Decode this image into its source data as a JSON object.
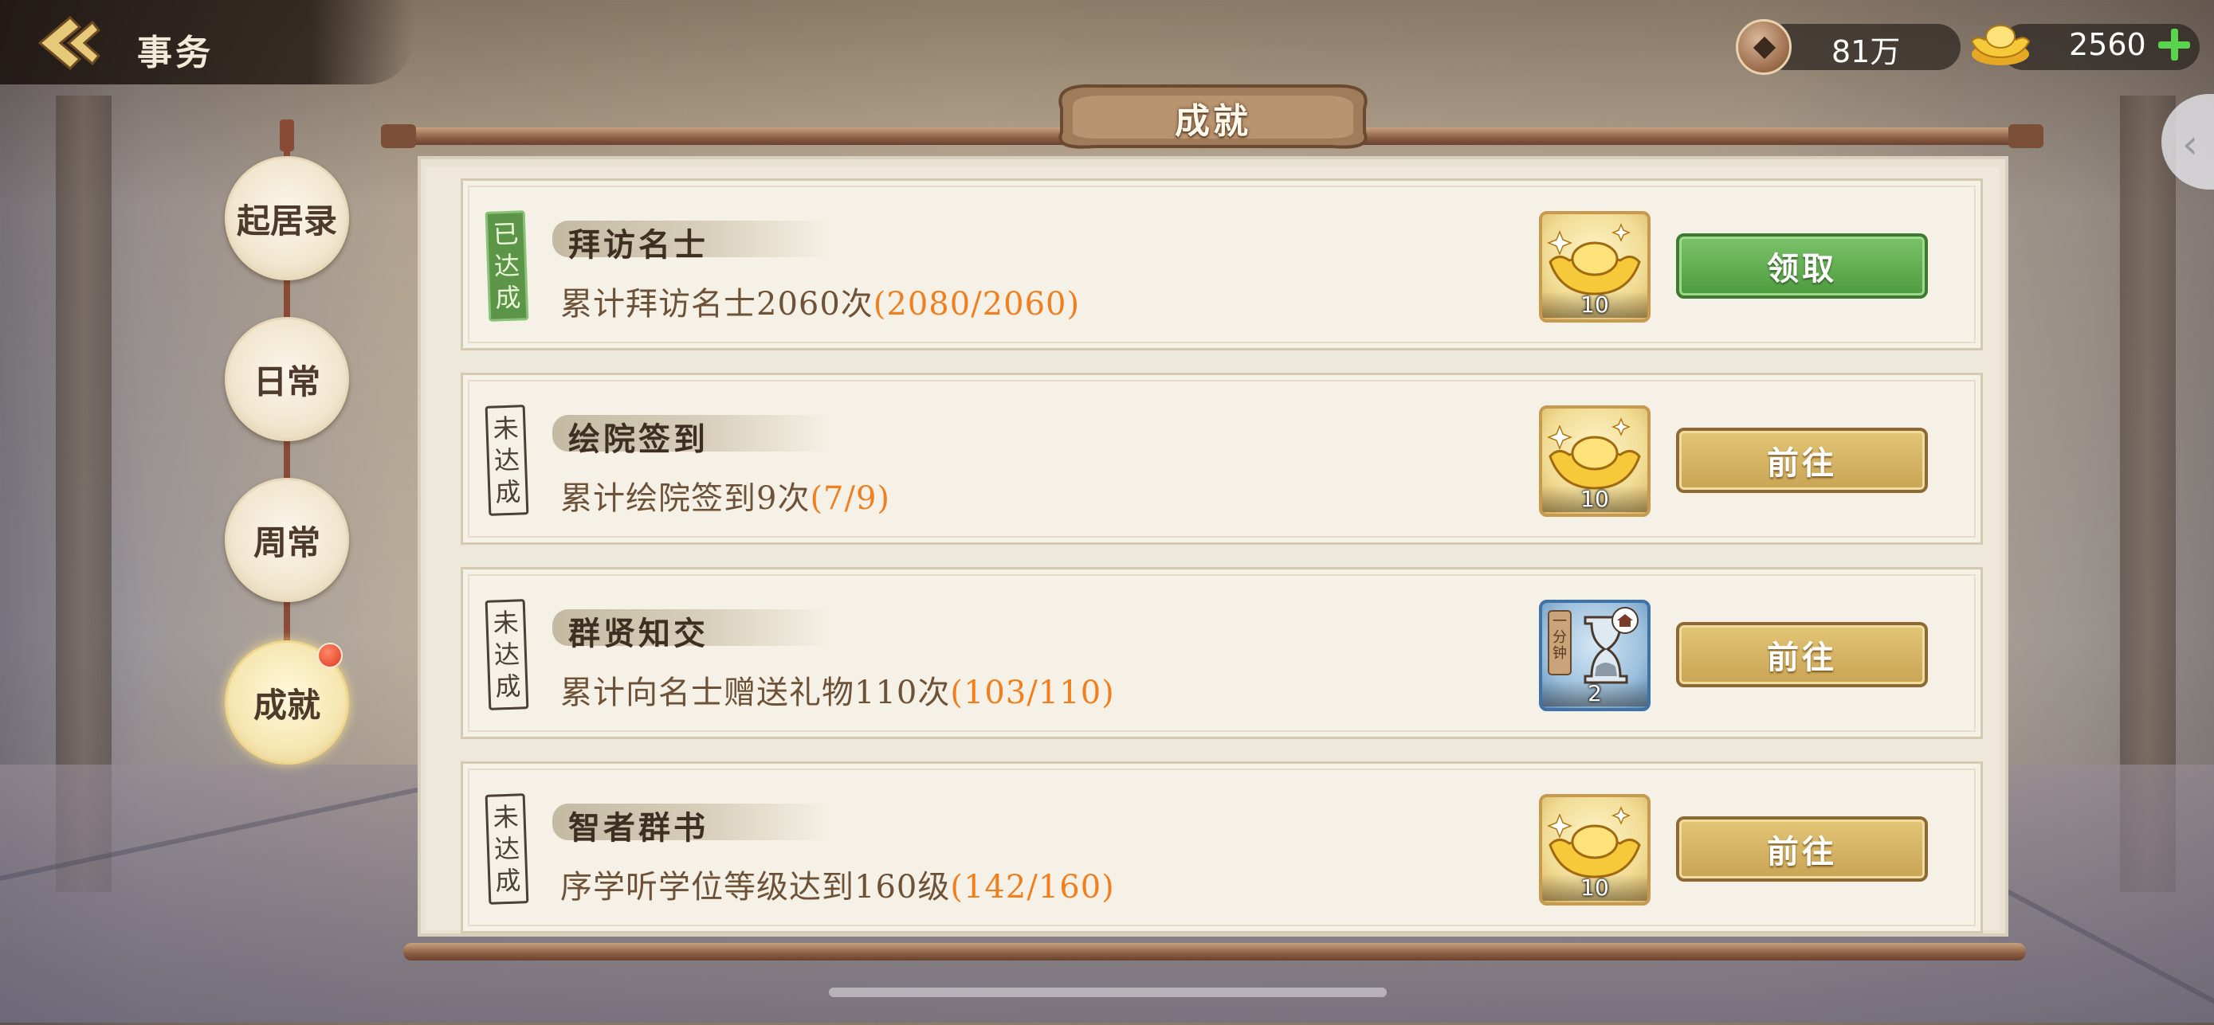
{
  "header": {
    "title": "事务"
  },
  "currency": {
    "copper": "81万",
    "ingot": "2560"
  },
  "nav": [
    {
      "label": "起居录",
      "active": false
    },
    {
      "label": "日常",
      "active": false
    },
    {
      "label": "周常",
      "active": false
    },
    {
      "label": "成就",
      "active": true,
      "has_notification": true
    }
  ],
  "panel": {
    "title": "成就"
  },
  "achievements": [
    {
      "status": [
        "已",
        "达",
        "成"
      ],
      "title": "拜访名士",
      "description": "累计拜访名士2060次",
      "progress": "(2080/2060)",
      "reward_icon": "gold-ingot-icon",
      "reward_qty": "10",
      "button": "领取"
    },
    {
      "status": [
        "未",
        "达",
        "成"
      ],
      "title": "绘院签到",
      "description": "累计绘院签到9次",
      "progress": "(7/9)",
      "reward_icon": "gold-ingot-icon",
      "reward_qty": "10",
      "button": "前往"
    },
    {
      "status": [
        "未",
        "达",
        "成"
      ],
      "title": "群贤知交",
      "description": "累计向名士赠送礼物110次",
      "progress": "(103/110)",
      "reward_icon": "hourglass-icon",
      "reward_label": "一分钟",
      "reward_qty": "2",
      "button": "前往"
    },
    {
      "status": [
        "未",
        "达",
        "成"
      ],
      "title": "智者群书",
      "description": "序学听学位等级达到160级",
      "progress": "(142/160)",
      "reward_icon": "gold-ingot-icon",
      "reward_qty": "10",
      "button": "前往"
    }
  ],
  "colors": {
    "progress": "#ef7f1f",
    "claim_button": "#5ba34a",
    "go_button": "#d3b263",
    "notification_dot": "#e0361e"
  }
}
